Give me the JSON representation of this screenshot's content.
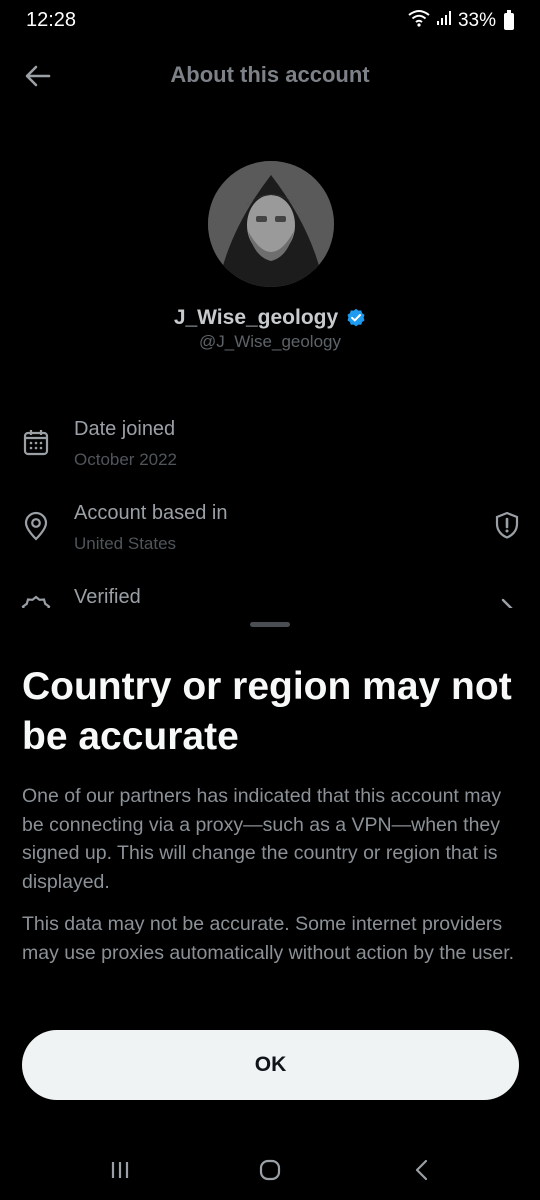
{
  "status_bar": {
    "time": "12:28",
    "battery": "33%",
    "icons": [
      "wifi-icon",
      "signal-icon",
      "battery-icon"
    ]
  },
  "header": {
    "title": "About this account",
    "back_icon": "arrow-left-icon"
  },
  "profile": {
    "display_name": "J_Wise_geology",
    "handle": "@J_Wise_geology",
    "verified": true,
    "verified_color": "#1d9bf0"
  },
  "info_items": [
    {
      "icon": "calendar-icon",
      "label": "Date joined",
      "value": "October 2022"
    },
    {
      "icon": "location-pin-icon",
      "label": "Account based in",
      "value": "United States",
      "trailing_icon": "shield-exclamation-icon"
    },
    {
      "icon": "verified-badge-icon",
      "label": "Verified",
      "trailing_icon": "chevron-right-icon"
    }
  ],
  "sheet": {
    "title": "Country or region may not be accurate",
    "paragraph_1": "One of our partners has indicated that this account may be connecting via a proxy—such as a VPN—when they signed up. This will change the country or region that is displayed.",
    "paragraph_2": "This data may not be accurate. Some internet providers may use proxies automatically without action by the user.",
    "ok_label": "OK"
  },
  "nav_bar": {
    "icons": [
      "recent-apps-icon",
      "home-icon",
      "back-icon"
    ]
  },
  "colors": {
    "background": "#000000",
    "text_primary": "#f7f9f9",
    "text_secondary": "#8b9196",
    "button_bg": "#eff3f4",
    "accent": "#1d9bf0"
  }
}
